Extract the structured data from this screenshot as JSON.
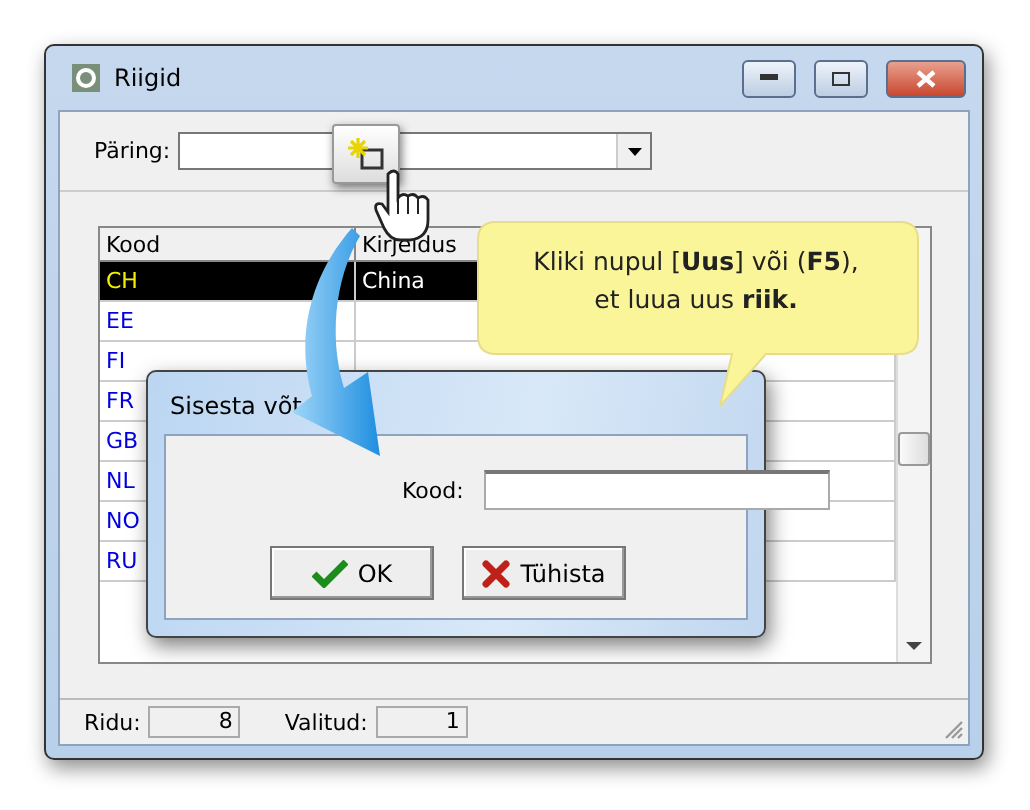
{
  "window": {
    "title": "Riigid"
  },
  "query": {
    "label": "Päring:"
  },
  "table": {
    "columns": [
      "Kood",
      "Kirjeldus"
    ],
    "rows": [
      {
        "code": "CH",
        "description": "China",
        "selected": true
      },
      {
        "code": "EE",
        "selected": false
      },
      {
        "code": "FI",
        "selected": false
      },
      {
        "code": "FR",
        "selected": false
      },
      {
        "code": "GB",
        "selected": false
      },
      {
        "code": "NL",
        "selected": false
      },
      {
        "code": "NO",
        "selected": false
      },
      {
        "code": "RU",
        "selected": false
      }
    ]
  },
  "status_bar": {
    "rows_label": "Ridu:",
    "rows_value": "8",
    "selected_label": "Valitud:",
    "selected_value": "1"
  },
  "dialog": {
    "title": "Sisesta võt",
    "field_label": "Kood:",
    "buttons": [
      {
        "label": "OK",
        "kind": "ok"
      },
      {
        "label": "Tühista",
        "kind": "cancel"
      }
    ]
  },
  "callout": {
    "lines": [
      "Kliki nupul [**Uus**] või (**F5**),",
      "et luua uus **riik.**"
    ]
  }
}
